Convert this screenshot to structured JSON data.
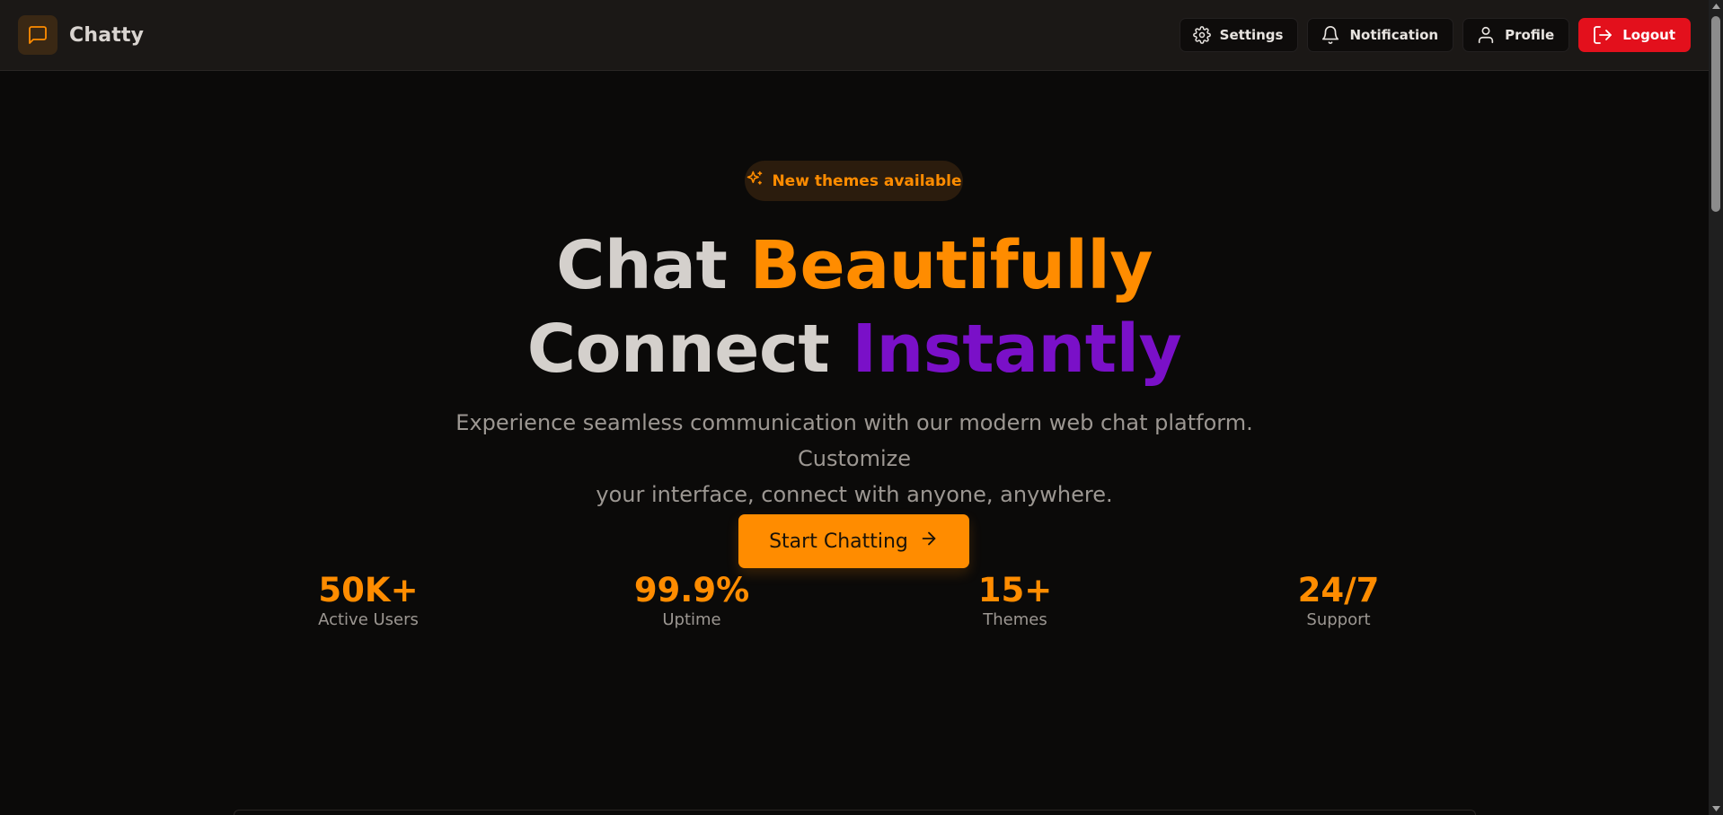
{
  "header": {
    "brand_name": "Chatty",
    "nav": {
      "settings": "Settings",
      "notification": "Notification",
      "profile": "Profile",
      "logout": "Logout"
    }
  },
  "hero": {
    "badge": "New themes available",
    "headline_line1_a": "Chat",
    "headline_line1_b": "Beautifully",
    "headline_line2_a": "Connect",
    "headline_line2_b": "Instantly",
    "subtitle_line1": "Experience seamless communication with our modern web chat platform. Customize",
    "subtitle_line2": "your interface, connect with anyone, anywhere.",
    "cta": "Start Chatting"
  },
  "stats": [
    {
      "value": "50K+",
      "label": "Active Users"
    },
    {
      "value": "99.9%",
      "label": "Uptime"
    },
    {
      "value": "15+",
      "label": "Themes"
    },
    {
      "value": "24/7",
      "label": "Support"
    }
  ],
  "colors": {
    "accent": "#ff8c00",
    "purple": "#7a10c8",
    "logout": "#e3101c",
    "background": "#0b0a09",
    "header": "#1b1816"
  },
  "icons": {
    "brand": "message-square-icon",
    "settings": "gear-icon",
    "notification": "bell-icon",
    "profile": "user-icon",
    "logout": "logout-icon",
    "badge": "sparkles-icon",
    "cta": "arrow-right-icon"
  }
}
